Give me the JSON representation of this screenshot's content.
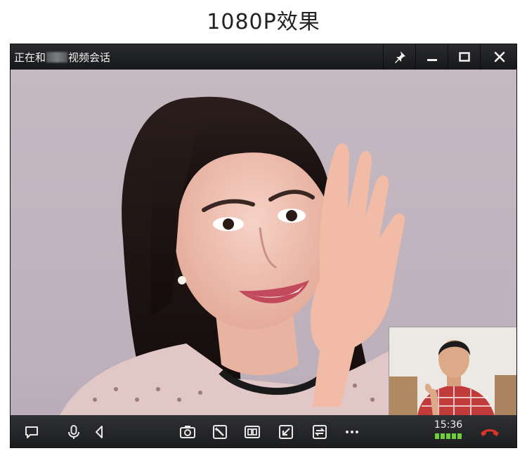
{
  "heading": "1080P效果",
  "window": {
    "title_prefix": "正在和",
    "title_suffix": "视频会话",
    "buttons": {
      "pin_icon": "pin-icon",
      "minimize_icon": "minimize-icon",
      "maximize_icon": "maximize-icon",
      "close_icon": "close-icon"
    }
  },
  "video": {
    "background_color": "#c3b7c0"
  },
  "toolbar": {
    "left_icons": [
      "chat-bubble-icon",
      "microphone-icon",
      "speaker-icon"
    ],
    "center_icons": [
      "camera-icon",
      "magic-effect-icon",
      "dual-view-icon",
      "minimize-window-icon",
      "switch-camera-icon",
      "more-icon"
    ],
    "call_time": "15:36",
    "signal_bars": 5,
    "signal_color": "#6fcf3a",
    "hangup_color": "#d9342b",
    "hangup_icon": "hang-up-icon"
  }
}
